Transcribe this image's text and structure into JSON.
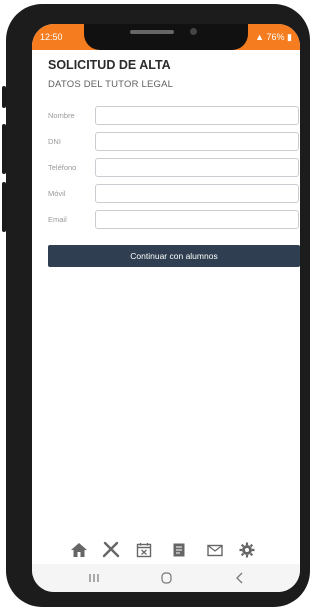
{
  "status_bar": {
    "time": "12:50",
    "battery": "76%",
    "bar_color": "#f57c1f"
  },
  "form": {
    "title": "SOLICITUD DE ALTA",
    "subtitle": "DATOS DEL TUTOR LEGAL",
    "fields": [
      {
        "label": "Nombre",
        "value": ""
      },
      {
        "label": "DNI",
        "value": ""
      },
      {
        "label": "Teléfono",
        "value": ""
      },
      {
        "label": "Móvil",
        "value": ""
      },
      {
        "label": "Email",
        "value": ""
      }
    ],
    "continue_label": "Continuar con alumnos",
    "button_color": "#2f3e51"
  },
  "bottom_tabs": [
    "home-icon",
    "tools-icon",
    "calendar-icon",
    "notes-icon",
    "mail-icon",
    "settings-icon"
  ],
  "system_nav": [
    "recent-apps-icon",
    "home-nav-icon",
    "back-icon"
  ]
}
